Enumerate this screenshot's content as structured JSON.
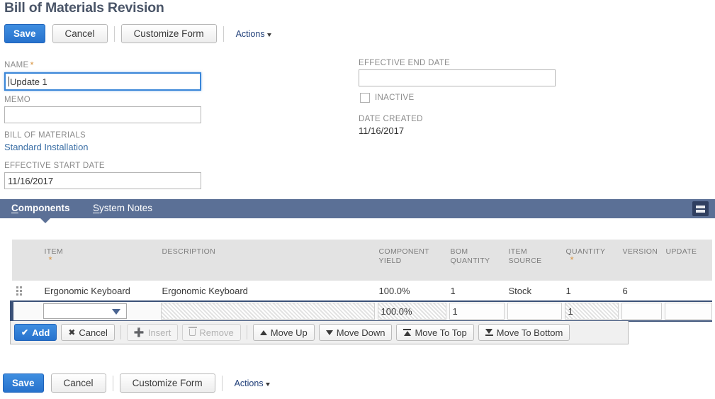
{
  "page": {
    "title": "Bill of Materials Revision"
  },
  "toolbar": {
    "save_label": "Save",
    "cancel_label": "Cancel",
    "customize_label": "Customize Form",
    "actions_label": "Actions"
  },
  "toolbar_bottom": {
    "save_label": "Save",
    "cancel_label": "Cancel",
    "customize_label": "Customize Form",
    "actions_label": "Actions"
  },
  "form": {
    "name": {
      "label": "NAME",
      "required": "*",
      "value": "Update 1"
    },
    "memo": {
      "label": "MEMO",
      "value": ""
    },
    "bill_of_materials": {
      "label": "BILL OF MATERIALS",
      "value": "Standard Installation"
    },
    "effective_start_date": {
      "label": "EFFECTIVE START DATE",
      "value": "11/16/2017"
    },
    "effective_end_date": {
      "label": "EFFECTIVE END DATE",
      "value": ""
    },
    "inactive": {
      "label": "INACTIVE",
      "checked": false
    },
    "date_created": {
      "label": "DATE CREATED",
      "value": "11/16/2017"
    }
  },
  "tabs": {
    "items": [
      {
        "label": "Components",
        "accesskey": "C",
        "active": true
      },
      {
        "label": "System Notes",
        "accesskey": "S",
        "active": false
      }
    ],
    "list_view_icon": "list-view-icon"
  },
  "sublist": {
    "columns": [
      {
        "label": "",
        "required": ""
      },
      {
        "label": "ITEM",
        "required": "*"
      },
      {
        "label": "DESCRIPTION",
        "required": ""
      },
      {
        "label": "COMPONENT YIELD",
        "required": ""
      },
      {
        "label": "BOM QUANTITY",
        "required": ""
      },
      {
        "label": "ITEM SOURCE",
        "required": ""
      },
      {
        "label": "QUANTITY",
        "required": "*"
      },
      {
        "label": "VERSION",
        "required": ""
      },
      {
        "label": "UPDATE",
        "required": ""
      }
    ],
    "rows": [
      {
        "item": "Ergonomic Keyboard",
        "description": "Ergonomic Keyboard",
        "component_yield": "100.0%",
        "bom_quantity": "1",
        "item_source": "Stock",
        "quantity": "1",
        "version": "6",
        "update": ""
      }
    ],
    "edit_row": {
      "item": "",
      "description": "",
      "component_yield": "100.0%",
      "bom_quantity": "1",
      "item_source": "",
      "quantity": "1",
      "version": "",
      "update": ""
    },
    "actions": [
      {
        "name": "add",
        "label": "Add",
        "icon": "check-icon",
        "state": "primary"
      },
      {
        "name": "cancel",
        "label": "Cancel",
        "icon": "cross-icon",
        "state": "normal"
      },
      {
        "name": "insert",
        "label": "Insert",
        "icon": "plus-icon",
        "state": "disabled"
      },
      {
        "name": "remove",
        "label": "Remove",
        "icon": "trash-icon",
        "state": "disabled"
      },
      {
        "name": "move-up",
        "label": "Move Up",
        "icon": "arrow-up-icon",
        "state": "normal"
      },
      {
        "name": "move-down",
        "label": "Move Down",
        "icon": "arrow-down-icon",
        "state": "normal"
      },
      {
        "name": "move-to-top",
        "label": "Move To Top",
        "icon": "arrow-to-top-icon",
        "state": "normal"
      },
      {
        "name": "move-to-bottom",
        "label": "Move To Bottom",
        "icon": "arrow-to-bottom-icon",
        "state": "normal"
      }
    ]
  },
  "colors": {
    "primary_blue": "#2772cd",
    "tab_bar": "#5b7096",
    "title_gray": "#4a5568",
    "required_orange": "#d89441",
    "link_blue": "#3a6ea5",
    "edit_row_border": "#3b5178"
  }
}
